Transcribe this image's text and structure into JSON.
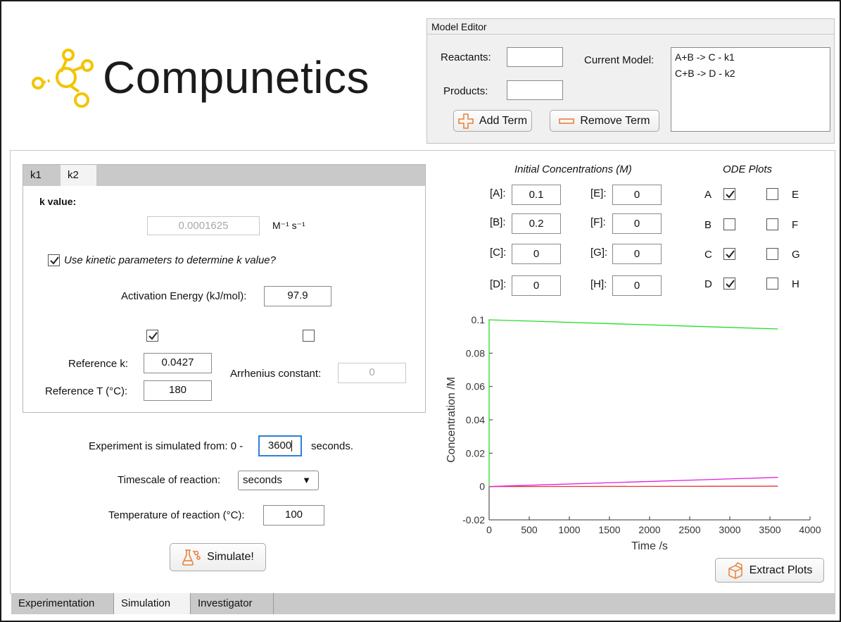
{
  "brand": {
    "name": "Compunetics"
  },
  "model_editor": {
    "title": "Model Editor",
    "reactants_label": "Reactants:",
    "reactants_value": "",
    "products_label": "Products:",
    "products_value": "",
    "add_term_label": "Add Term",
    "remove_term_label": "Remove Term",
    "current_model_label": "Current Model:",
    "model_terms": [
      "A+B -> C  - k1",
      "C+B -> D  - k2"
    ]
  },
  "k_tabs": [
    {
      "label": "k1",
      "active": false
    },
    {
      "label": "k2",
      "active": true
    }
  ],
  "k_panel": {
    "k_value_label": "k value:",
    "k_value": "0.0001625",
    "k_units": "M⁻¹ s⁻¹",
    "use_kinetic_label": "Use kinetic parameters to determine k value?",
    "use_kinetic_checked": true,
    "activation_energy_label": "Activation Energy (kJ/mol):",
    "activation_energy_value": "97.9",
    "reference_checked": true,
    "arrhenius_checked": false,
    "reference_k_label": "Reference k:",
    "reference_k_value": "0.0427",
    "reference_t_label": "Reference T (°C):",
    "reference_t_value": "180",
    "arrhenius_label": "Arrhenius constant:",
    "arrhenius_value": "0"
  },
  "simulation": {
    "simulated_from_label": "Experiment is simulated from: 0  -",
    "end_time_value": "3600",
    "seconds_label": "seconds.",
    "timescale_label": "Timescale of reaction:",
    "timescale_value": "seconds",
    "temperature_label": "Temperature of reaction (°C):",
    "temperature_value": "100",
    "simulate_label": "Simulate!"
  },
  "initial_concentrations": {
    "title": "Initial Concentrations (M)",
    "species": [
      {
        "label": "[A]:",
        "value": "0.1"
      },
      {
        "label": "[B]:",
        "value": "0.2"
      },
      {
        "label": "[C]:",
        "value": "0"
      },
      {
        "label": "[D]:",
        "value": "0"
      },
      {
        "label": "[E]:",
        "value": "0"
      },
      {
        "label": "[F]:",
        "value": "0"
      },
      {
        "label": "[G]:",
        "value": "0"
      },
      {
        "label": "[H]:",
        "value": "0"
      }
    ]
  },
  "ode_plots": {
    "title": "ODE Plots",
    "items": [
      {
        "label": "A",
        "checked": true
      },
      {
        "label": "B",
        "checked": false
      },
      {
        "label": "C",
        "checked": true
      },
      {
        "label": "D",
        "checked": true
      },
      {
        "label": "E",
        "checked": false
      },
      {
        "label": "F",
        "checked": false
      },
      {
        "label": "G",
        "checked": false
      },
      {
        "label": "H",
        "checked": false
      }
    ]
  },
  "extract_plots_label": "Extract Plots",
  "bottom_tabs": [
    {
      "label": "Experimentation",
      "active": false
    },
    {
      "label": "Simulation",
      "active": true
    },
    {
      "label": "Investigator",
      "active": false
    }
  ],
  "colors": {
    "brand_yellow": "#f2c500",
    "accent_orange": "#e8823a",
    "series_a": "#22dd22",
    "series_c": "#e8353a",
    "series_d": "#e020e0"
  },
  "chart_data": {
    "type": "line",
    "xlabel": "Time /s",
    "ylabel": "Concentration /M",
    "xlim": [
      0,
      4000
    ],
    "ylim": [
      -0.02,
      0.1
    ],
    "xticks": [
      0,
      500,
      1000,
      1500,
      2000,
      2500,
      3000,
      3500,
      4000
    ],
    "yticks": [
      -0.02,
      0,
      0.02,
      0.04,
      0.06,
      0.08,
      0.1
    ],
    "ytick_labels": [
      "-0.02",
      "0",
      "0.02",
      "0.04",
      "0.06",
      "0.08",
      "0.1"
    ],
    "grid": false,
    "series": [
      {
        "species": "A",
        "color": "#22dd22",
        "x": [
          0,
          0,
          3600
        ],
        "y": [
          0,
          0.1,
          0.0945
        ]
      },
      {
        "species": "C",
        "color": "#e8353a",
        "x": [
          0,
          3600
        ],
        "y": [
          0,
          0.0002
        ]
      },
      {
        "species": "D",
        "color": "#e020e0",
        "x": [
          0,
          3600
        ],
        "y": [
          0,
          0.0055
        ]
      }
    ]
  }
}
